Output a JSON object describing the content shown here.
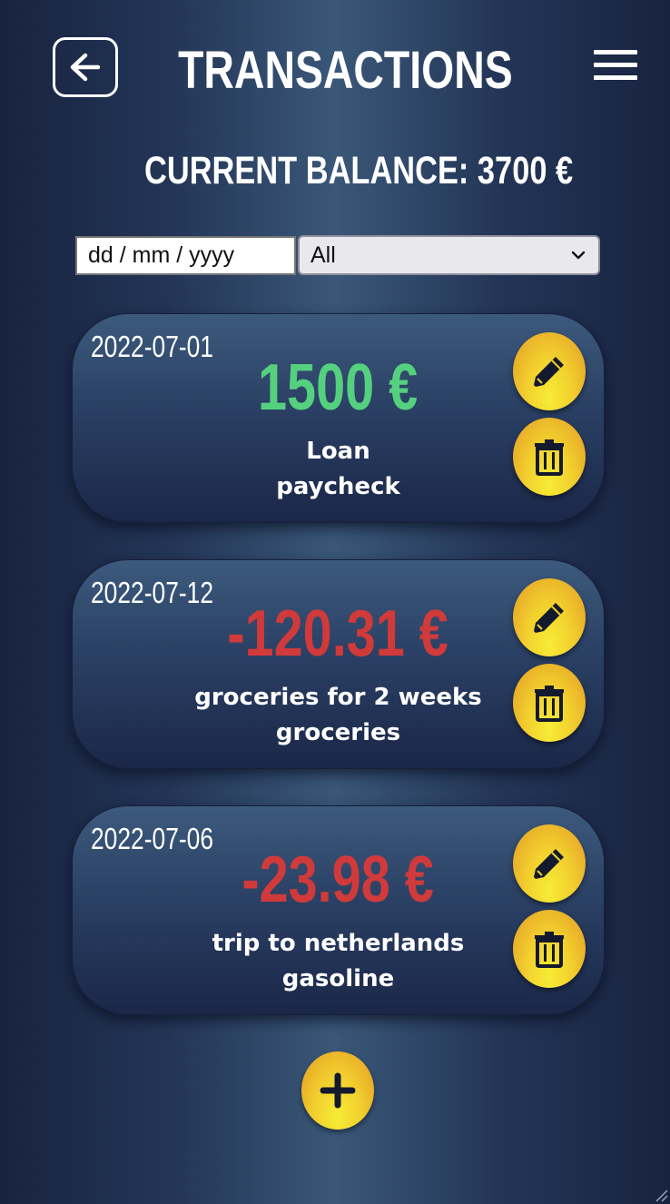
{
  "header": {
    "title": "TRANSACTIONS",
    "balance_text": "CURRENT BALANCE: 3700 €"
  },
  "filters": {
    "date_placeholder": "dd / mm / yyyy",
    "type_selected": "All"
  },
  "transactions": [
    {
      "date": "2022-07-01",
      "amount": "1500 €",
      "kind": "positive",
      "description": "Loan",
      "category": "paycheck"
    },
    {
      "date": "2022-07-12",
      "amount": "-120.31 €",
      "kind": "negative",
      "description": "groceries for 2 weeks",
      "category": "groceries"
    },
    {
      "date": "2022-07-06",
      "amount": "-23.98 €",
      "kind": "negative",
      "description": "trip to netherlands",
      "category": "gasoline"
    }
  ],
  "icons": {
    "back": "arrow-left-icon",
    "menu": "hamburger-menu-icon",
    "edit": "pencil-icon",
    "delete": "trash-icon",
    "add": "plus-icon",
    "select": "chevron-down-icon"
  },
  "colors": {
    "positive_amount": "#55d07f",
    "negative_amount": "#d13a3a",
    "button_accent": "#f2cf2e",
    "card_background": "#2a4064"
  }
}
